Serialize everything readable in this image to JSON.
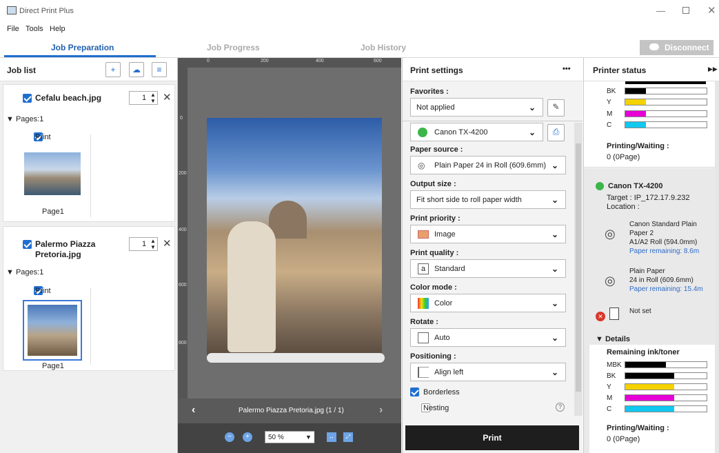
{
  "window": {
    "title": "Direct Print Plus"
  },
  "menu": [
    "File",
    "Tools",
    "Help"
  ],
  "tabs": {
    "prep": "Job Preparation",
    "progress": "Job Progress",
    "history": "Job History"
  },
  "disconnect": "Disconnect",
  "joblist": {
    "title": "Job list",
    "jobs": [
      {
        "name": "Cefalu beach.jpg",
        "copies": "1",
        "pages": "Pages:1",
        "print": "Print",
        "page": "Page1"
      },
      {
        "name": "Palermo Piazza Pretoria.jpg",
        "name1": "Palermo Piazza",
        "name2": "Pretoria.jpg",
        "copies": "1",
        "pages": "Pages:1",
        "print": "Print",
        "page": "Page1"
      }
    ]
  },
  "preview": {
    "ruler_top": [
      "0",
      "200",
      "400",
      "600"
    ],
    "ruler_left": [
      "0",
      "200",
      "400",
      "600",
      "800"
    ],
    "filename": "Palermo Piazza Pretoria.jpg (1 / 1)",
    "zoom": "50 %"
  },
  "settings": {
    "title": "Print settings",
    "more": "•••",
    "favorites_label": "Favorites :",
    "favorites": "Not applied",
    "printer": "Canon TX-4200",
    "paper_source_label": "Paper source :",
    "paper_source": "Plain Paper 24 in Roll (609.6mm)",
    "output_size_label": "Output size :",
    "output_size": "Fit short side to roll paper width",
    "priority_label": "Print priority :",
    "priority": "Image",
    "quality_label": "Print quality :",
    "quality": "Standard",
    "color_label": "Color mode :",
    "color": "Color",
    "rotate_label": "Rotate :",
    "rotate": "Auto",
    "positioning_label": "Positioning :",
    "positioning": "Align left",
    "borderless": "Borderless",
    "nesting": "Nesting",
    "print_button": "Print"
  },
  "status": {
    "title": "Printer status",
    "top_inks": [
      {
        "name": "BK",
        "level": 0.25,
        "color": "#000000"
      },
      {
        "name": "Y",
        "level": 0.25,
        "color": "#f4d200"
      },
      {
        "name": "M",
        "level": 0.25,
        "color": "#e600d6"
      },
      {
        "name": "C",
        "level": 0.25,
        "color": "#10c8f0"
      }
    ],
    "waiting_label": "Printing/Waiting :",
    "waiting": "0 (0Page)",
    "printer": "Canon TX-4200",
    "target": "Target : IP_172.17.9.232",
    "location": "Location :",
    "roll1": {
      "line1": "Canon Standard Plain",
      "line2": "Paper 2",
      "line3": "A1/A2 Roll (594.0mm)",
      "remaining": "Paper remaining:  8.6m"
    },
    "roll2": {
      "line1": "Plain Paper",
      "line2": "24 in Roll (609.6mm)",
      "remaining": "Paper remaining:  15.4m"
    },
    "roll3": "Not set",
    "details": "Details",
    "remaining_label": "Remaining ink/toner",
    "inks": [
      {
        "name": "MBK",
        "level": 0.5,
        "color": "#000000"
      },
      {
        "name": "BK",
        "level": 0.6,
        "color": "#000000"
      },
      {
        "name": "Y",
        "level": 0.6,
        "color": "#f4d200"
      },
      {
        "name": "M",
        "level": 0.6,
        "color": "#e600d6"
      },
      {
        "name": "C",
        "level": 0.6,
        "color": "#10c8f0"
      }
    ],
    "waiting2_label": "Printing/Waiting :",
    "waiting2": "0 (0Page)"
  }
}
